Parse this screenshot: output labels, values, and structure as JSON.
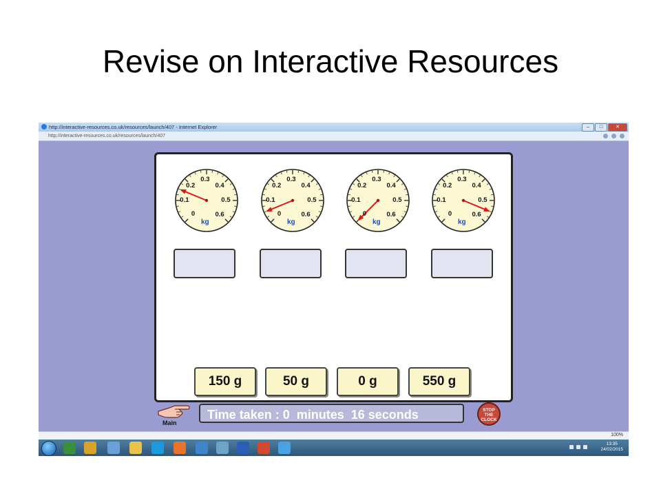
{
  "slide": {
    "title": "Revise on Interactive Resources"
  },
  "browser": {
    "window_title": "http://interactive-resources.co.uk/resources/launch/407 - Internet Explorer",
    "address": "http://interactive-resources.co.uk/resources/launch/407",
    "status_zoom": "100%"
  },
  "activity": {
    "dials": [
      {
        "labels": [
          "0",
          "0.1",
          "0.2",
          "0.3",
          "0.4",
          "0.5",
          "0.6"
        ],
        "unit": "kg",
        "reading_kg": 0.15
      },
      {
        "labels": [
          "0",
          "0.1",
          "0.2",
          "0.3",
          "0.4",
          "0.5",
          "0.6"
        ],
        "unit": "kg",
        "reading_kg": 0.05
      },
      {
        "labels": [
          "0",
          "0.1",
          "0.2",
          "0.3",
          "0.4",
          "0.5",
          "0.6"
        ],
        "unit": "kg",
        "reading_kg": 0
      },
      {
        "labels": [
          "0",
          "0.1",
          "0.2",
          "0.3",
          "0.4",
          "0.5",
          "0.6"
        ],
        "unit": "kg",
        "reading_kg": 0.55
      }
    ],
    "answer_cards": [
      "150 g",
      "50 g",
      "0 g",
      "550 g"
    ],
    "main_label": "Main",
    "timer_text": "Time taken : 0  minutes  16 seconds",
    "stop_button": [
      "STOP",
      "THE",
      "CLOCK"
    ]
  },
  "taskbar": {
    "time": "13:35",
    "date": "24/02/2015"
  },
  "colors": {
    "background": "#9a9bd0",
    "pointer": "#e01818",
    "card": "#fbf6c9",
    "unit": "#1f4fb0"
  }
}
